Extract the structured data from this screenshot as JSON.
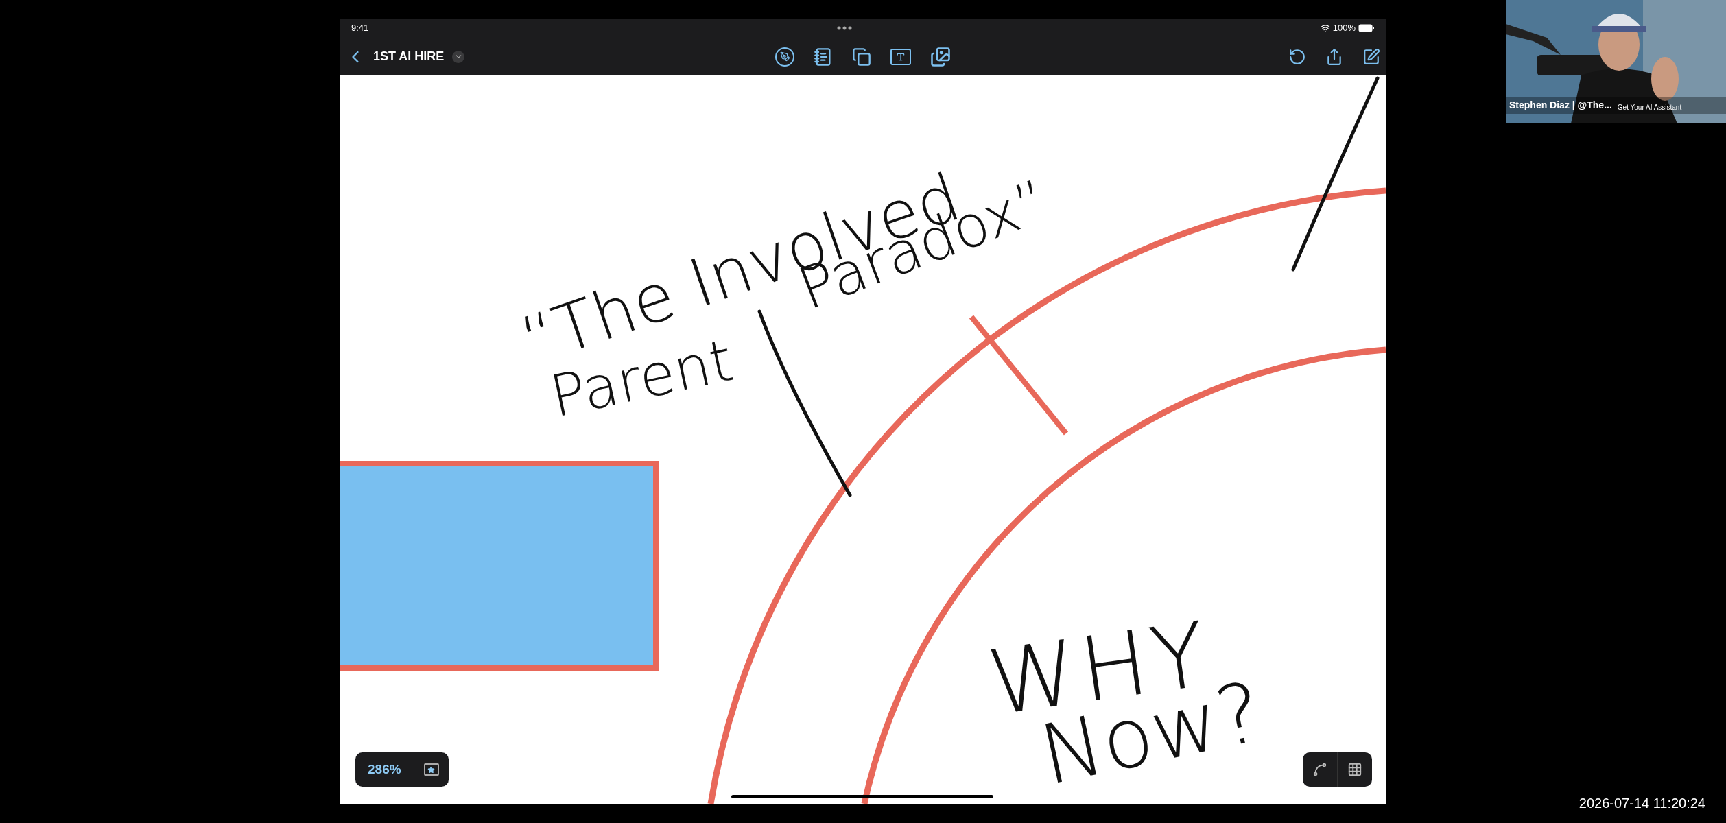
{
  "status_bar": {
    "time": "9:41",
    "battery": "100%"
  },
  "toolbar": {
    "title": "1ST AI HIRE"
  },
  "canvas": {
    "notes": [
      {
        "text": "“The Involved"
      },
      {
        "text": "Paradox”"
      },
      {
        "text": "Parent"
      },
      {
        "text": "WHY"
      },
      {
        "text": "Now?"
      }
    ]
  },
  "zoom": {
    "label": "286%"
  },
  "webcam": {
    "name": "Stephen Diaz | @The...",
    "caption": "Get Your AI Assistant"
  },
  "timestamp": "2026-07-14 11:20:24"
}
